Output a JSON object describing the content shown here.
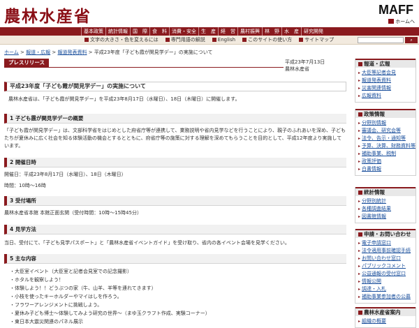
{
  "header": {
    "logo": "農林水産省",
    "maff": "MAFF",
    "home_link": "ホームへ"
  },
  "gnav": [
    "基本政策",
    "統計情報",
    "国　際",
    "食　料",
    "消費・安全",
    "生　産",
    "経　営",
    "農村振興",
    "林　野",
    "水　産",
    "研究開発"
  ],
  "subnav": {
    "items": [
      "文字の大きさ・色を変えるには",
      "専門用語の解説",
      "English",
      "このサイトの使い方",
      "サイトマップ"
    ]
  },
  "breadcrumb": [
    "ホーム",
    "報道・広報",
    "報道発表資料",
    "平成23年度「子ども霞が関見学デー」の実施について"
  ],
  "press": {
    "tab": "プレスリリース",
    "date": "平成23年7月13日",
    "org": "農林水産省"
  },
  "title": "平成23年度「子ども霞が関見学デー」の実施について",
  "lead": "農林水産省は、「子ども霞が関見学デー」を平成23年8月17日（水曜日）、18日（木曜日）に開催します。",
  "sections": {
    "s1": {
      "heading": "1 子ども霞が関見学デーの概要",
      "body": "「子ども霞が関見学デー」は、文部科学省をはじめとした府省庁等が連携して、業務説明や省内見学などを行うことにより、親子のふれあいを深め、子どもたちが夏休みに広く社会を知る体験活動の機会とするとともに、府省庁等の施策に対する理解を深めてもらうことを目的として、平成12年度より実施しています。"
    },
    "s2": {
      "heading": "2 開催日時",
      "body1": "開催日：平成23年8月17日（水曜日）、18日（木曜日）",
      "body2": "時間：10時～16時"
    },
    "s3": {
      "heading": "3 受付場所",
      "body": "農林水産省本館 本館正面玄関（受付時間：10時～15時45分）"
    },
    "s4": {
      "heading": "4 見学方法",
      "body": "当日、受付にて、「子ども見学パスポート」と「農林水産省イベントガイド」を受け取り、省内の各イベント会場を見学ください。"
    },
    "s5": {
      "heading": "5 主な内容",
      "items": [
        "大臣室イベント（大臣室と記者会見室での記念撮影）",
        "ホタルを観察しよう！",
        "体験しよう！！どうぶつの家（牛、山羊、羊等を連れてきます）",
        "小枝を使ったキーホルダーやマイはしを作ろう。",
        "フラワーアレンジメントに挑戦しよう。",
        "夏休み子ども博士～体験してみよう研究の世界～（まゆ玉クラフト作成、実験コーナー）",
        "東日本大震災関連のパネル展示"
      ]
    }
  },
  "sidebar": {
    "box1": {
      "title": "報道・広報",
      "items": [
        "大臣等記者会見",
        "報道発表資料",
        "災害関連情報",
        "広報資料"
      ]
    },
    "box2": {
      "title": "政策情報",
      "items": [
        "分野別情報",
        "審議会、研究会等",
        "法令、告示・通知等",
        "予算、決算、財務資料等",
        "補助事業、税制",
        "政策評価",
        "白書情報"
      ]
    },
    "box3": {
      "title": "統計情報",
      "items": [
        "分野別統計",
        "各種調査結果",
        "図書館情報"
      ]
    },
    "box4": {
      "title": "申請・お問い合わせ",
      "items": [
        "電子申請窓口",
        "法令適用事前確認手続",
        "お問い合わせ窓口",
        "パブリックコメント",
        "公益通報の受付窓口",
        "情報公開",
        "調達・入札",
        "補助事業参加者の公募"
      ]
    },
    "box5": {
      "title": "農林水産省案内",
      "items": [
        "組織の概要"
      ]
    }
  }
}
